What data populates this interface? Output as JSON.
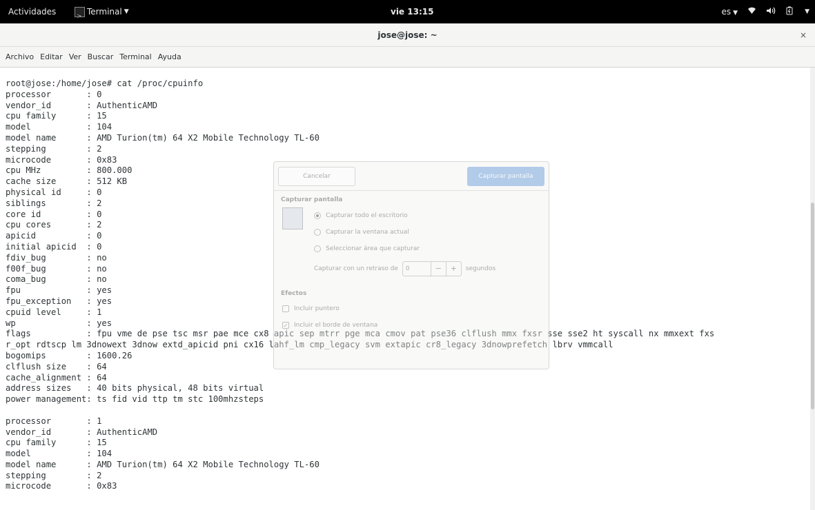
{
  "topbar": {
    "activities": "Actividades",
    "app_name": "Terminal",
    "app_arrow": "▼",
    "clock": "vie 13:15",
    "keyboard": "es",
    "wifi_icon": "wifi-icon",
    "volume_icon": "volume-icon",
    "battery_icon": "battery-icon"
  },
  "window": {
    "title": "jose@jose: ~",
    "close": "×"
  },
  "menu": {
    "archivo": "Archivo",
    "editar": "Editar",
    "ver": "Ver",
    "buscar": "Buscar",
    "terminal": "Terminal",
    "ayuda": "Ayuda"
  },
  "terminal": {
    "output": "root@jose:/home/jose# cat /proc/cpuinfo\nprocessor\t: 0\nvendor_id\t: AuthenticAMD\ncpu family\t: 15\nmodel\t\t: 104\nmodel name\t: AMD Turion(tm) 64 X2 Mobile Technology TL-60\nstepping\t: 2\nmicrocode\t: 0x83\ncpu MHz\t\t: 800.000\ncache size\t: 512 KB\nphysical id\t: 0\nsiblings\t: 2\ncore id\t\t: 0\ncpu cores\t: 2\napicid\t\t: 0\ninitial apicid\t: 0\nfdiv_bug\t: no\nf00f_bug\t: no\ncoma_bug\t: no\nfpu\t\t: yes\nfpu_exception\t: yes\ncpuid level\t: 1\nwp\t\t: yes\nflags\t\t: fpu vme de pse tsc msr pae mce cx8 apic sep mtrr pge mca cmov pat pse36 clflush mmx fxsr sse sse2 ht syscall nx mmxext fxs\nr_opt rdtscp lm 3dnowext 3dnow extd_apicid pni cx16 lahf_lm cmp_legacy svm extapic cr8_legacy 3dnowprefetch lbrv vmmcall\nbogomips\t: 1600.26\nclflush size\t: 64\ncache_alignment\t: 64\naddress sizes\t: 40 bits physical, 48 bits virtual\npower management: ts fid vid ttp tm stc 100mhzsteps\n\nprocessor\t: 1\nvendor_id\t: AuthenticAMD\ncpu family\t: 15\nmodel\t\t: 104\nmodel name\t: AMD Turion(tm) 64 X2 Mobile Technology TL-60\nstepping\t: 2\nmicrocode\t: 0x83"
  },
  "dialog": {
    "cancel": "Cancelar",
    "capture": "Capturar pantalla",
    "section_capture": "Capturar pantalla",
    "opt_whole": "Capturar todo el escritorio",
    "opt_window": "Capturar la ventana actual",
    "opt_area": "Seleccionar área que capturar",
    "delay_label": "Capturar con un retraso de",
    "delay_value": "0",
    "delay_minus": "−",
    "delay_plus": "+",
    "delay_unit": "segundos",
    "section_effects": "Efectos",
    "include_pointer": "Incluir puntero",
    "include_border": "Incluir el borde de ventana"
  }
}
